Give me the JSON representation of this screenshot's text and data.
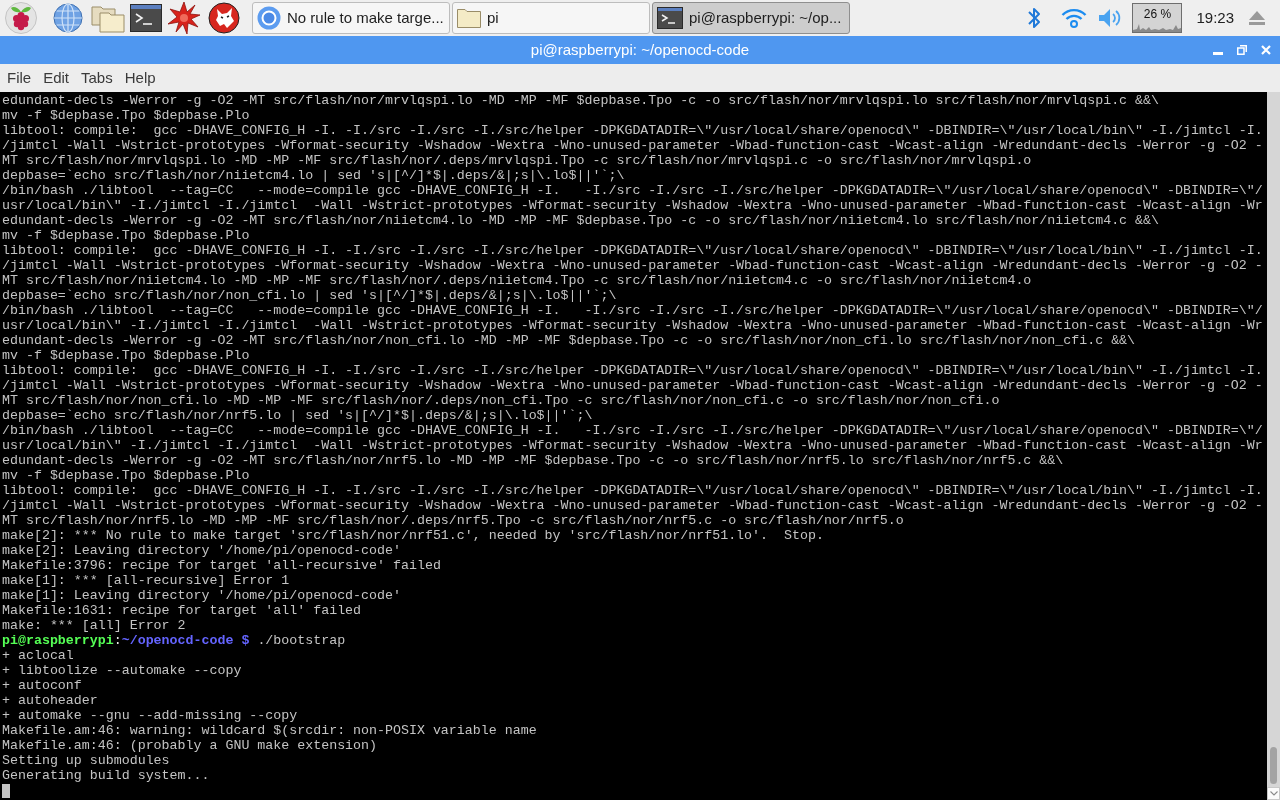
{
  "taskbar": {
    "tasks": [
      {
        "kind": "browser",
        "label": "No rule to make targe...",
        "selected": false
      },
      {
        "kind": "folder",
        "label": "pi",
        "selected": false
      },
      {
        "kind": "terminal",
        "label": "pi@raspberrypi: ~/op...",
        "selected": true
      }
    ],
    "cpu": "26 %",
    "clock": "19:23"
  },
  "window": {
    "title": "pi@raspberrypi: ~/openocd-code"
  },
  "menu": [
    "File",
    "Edit",
    "Tabs",
    "Help"
  ],
  "terminal": {
    "lines": [
      {
        "kind": "output",
        "text": "edundant-decls -Werror -g -O2 -MT src/flash/nor/mrvlqspi.lo -MD -MP -MF $depbase.Tpo -c -o src/flash/nor/mrvlqspi.lo src/flash/nor/mrvlqspi.c &&\\"
      },
      {
        "kind": "output",
        "text": "mv -f $depbase.Tpo $depbase.Plo"
      },
      {
        "kind": "output",
        "text": "libtool: compile:  gcc -DHAVE_CONFIG_H -I. -I./src -I./src -I./src/helper -DPKGDATADIR=\\\"/usr/local/share/openocd\\\" -DBINDIR=\\\"/usr/local/bin\\\" -I./jimtcl -I."
      },
      {
        "kind": "output",
        "text": "/jimtcl -Wall -Wstrict-prototypes -Wformat-security -Wshadow -Wextra -Wno-unused-parameter -Wbad-function-cast -Wcast-align -Wredundant-decls -Werror -g -O2 -"
      },
      {
        "kind": "output",
        "text": "MT src/flash/nor/mrvlqspi.lo -MD -MP -MF src/flash/nor/.deps/mrvlqspi.Tpo -c src/flash/nor/mrvlqspi.c -o src/flash/nor/mrvlqspi.o"
      },
      {
        "kind": "output",
        "text": "depbase=`echo src/flash/nor/niietcm4.lo | sed 's|[^/]*$|.deps/&|;s|\\.lo$||'`;\\"
      },
      {
        "kind": "output",
        "text": "/bin/bash ./libtool  --tag=CC   --mode=compile gcc -DHAVE_CONFIG_H -I.   -I./src -I./src -I./src/helper -DPKGDATADIR=\\\"/usr/local/share/openocd\\\" -DBINDIR=\\\"/"
      },
      {
        "kind": "output",
        "text": "usr/local/bin\\\" -I./jimtcl -I./jimtcl  -Wall -Wstrict-prototypes -Wformat-security -Wshadow -Wextra -Wno-unused-parameter -Wbad-function-cast -Wcast-align -Wr"
      },
      {
        "kind": "output",
        "text": "edundant-decls -Werror -g -O2 -MT src/flash/nor/niietcm4.lo -MD -MP -MF $depbase.Tpo -c -o src/flash/nor/niietcm4.lo src/flash/nor/niietcm4.c &&\\"
      },
      {
        "kind": "output",
        "text": "mv -f $depbase.Tpo $depbase.Plo"
      },
      {
        "kind": "output",
        "text": "libtool: compile:  gcc -DHAVE_CONFIG_H -I. -I./src -I./src -I./src/helper -DPKGDATADIR=\\\"/usr/local/share/openocd\\\" -DBINDIR=\\\"/usr/local/bin\\\" -I./jimtcl -I."
      },
      {
        "kind": "output",
        "text": "/jimtcl -Wall -Wstrict-prototypes -Wformat-security -Wshadow -Wextra -Wno-unused-parameter -Wbad-function-cast -Wcast-align -Wredundant-decls -Werror -g -O2 -"
      },
      {
        "kind": "output",
        "text": "MT src/flash/nor/niietcm4.lo -MD -MP -MF src/flash/nor/.deps/niietcm4.Tpo -c src/flash/nor/niietcm4.c -o src/flash/nor/niietcm4.o"
      },
      {
        "kind": "output",
        "text": "depbase=`echo src/flash/nor/non_cfi.lo | sed 's|[^/]*$|.deps/&|;s|\\.lo$||'`;\\"
      },
      {
        "kind": "output",
        "text": "/bin/bash ./libtool  --tag=CC   --mode=compile gcc -DHAVE_CONFIG_H -I.   -I./src -I./src -I./src/helper -DPKGDATADIR=\\\"/usr/local/share/openocd\\\" -DBINDIR=\\\"/"
      },
      {
        "kind": "output",
        "text": "usr/local/bin\\\" -I./jimtcl -I./jimtcl  -Wall -Wstrict-prototypes -Wformat-security -Wshadow -Wextra -Wno-unused-parameter -Wbad-function-cast -Wcast-align -Wr"
      },
      {
        "kind": "output",
        "text": "edundant-decls -Werror -g -O2 -MT src/flash/nor/non_cfi.lo -MD -MP -MF $depbase.Tpo -c -o src/flash/nor/non_cfi.lo src/flash/nor/non_cfi.c &&\\"
      },
      {
        "kind": "output",
        "text": "mv -f $depbase.Tpo $depbase.Plo"
      },
      {
        "kind": "output",
        "text": "libtool: compile:  gcc -DHAVE_CONFIG_H -I. -I./src -I./src -I./src/helper -DPKGDATADIR=\\\"/usr/local/share/openocd\\\" -DBINDIR=\\\"/usr/local/bin\\\" -I./jimtcl -I."
      },
      {
        "kind": "output",
        "text": "/jimtcl -Wall -Wstrict-prototypes -Wformat-security -Wshadow -Wextra -Wno-unused-parameter -Wbad-function-cast -Wcast-align -Wredundant-decls -Werror -g -O2 -"
      },
      {
        "kind": "output",
        "text": "MT src/flash/nor/non_cfi.lo -MD -MP -MF src/flash/nor/.deps/non_cfi.Tpo -c src/flash/nor/non_cfi.c -o src/flash/nor/non_cfi.o"
      },
      {
        "kind": "output",
        "text": "depbase=`echo src/flash/nor/nrf5.lo | sed 's|[^/]*$|.deps/&|;s|\\.lo$||'`;\\"
      },
      {
        "kind": "output",
        "text": "/bin/bash ./libtool  --tag=CC   --mode=compile gcc -DHAVE_CONFIG_H -I.   -I./src -I./src -I./src/helper -DPKGDATADIR=\\\"/usr/local/share/openocd\\\" -DBINDIR=\\\"/"
      },
      {
        "kind": "output",
        "text": "usr/local/bin\\\" -I./jimtcl -I./jimtcl  -Wall -Wstrict-prototypes -Wformat-security -Wshadow -Wextra -Wno-unused-parameter -Wbad-function-cast -Wcast-align -Wr"
      },
      {
        "kind": "output",
        "text": "edundant-decls -Werror -g -O2 -MT src/flash/nor/nrf5.lo -MD -MP -MF $depbase.Tpo -c -o src/flash/nor/nrf5.lo src/flash/nor/nrf5.c &&\\"
      },
      {
        "kind": "output",
        "text": "mv -f $depbase.Tpo $depbase.Plo"
      },
      {
        "kind": "output",
        "text": "libtool: compile:  gcc -DHAVE_CONFIG_H -I. -I./src -I./src -I./src/helper -DPKGDATADIR=\\\"/usr/local/share/openocd\\\" -DBINDIR=\\\"/usr/local/bin\\\" -I./jimtcl -I."
      },
      {
        "kind": "output",
        "text": "/jimtcl -Wall -Wstrict-prototypes -Wformat-security -Wshadow -Wextra -Wno-unused-parameter -Wbad-function-cast -Wcast-align -Wredundant-decls -Werror -g -O2 -"
      },
      {
        "kind": "output",
        "text": "MT src/flash/nor/nrf5.lo -MD -MP -MF src/flash/nor/.deps/nrf5.Tpo -c src/flash/nor/nrf5.c -o src/flash/nor/nrf5.o"
      },
      {
        "kind": "output",
        "text": "make[2]: *** No rule to make target 'src/flash/nor/nrf51.c', needed by 'src/flash/nor/nrf51.lo'.  Stop."
      },
      {
        "kind": "output",
        "text": "make[2]: Leaving directory '/home/pi/openocd-code'"
      },
      {
        "kind": "output",
        "text": "Makefile:3796: recipe for target 'all-recursive' failed"
      },
      {
        "kind": "output",
        "text": "make[1]: *** [all-recursive] Error 1"
      },
      {
        "kind": "output",
        "text": "make[1]: Leaving directory '/home/pi/openocd-code'"
      },
      {
        "kind": "output",
        "text": "Makefile:1631: recipe for target 'all' failed"
      },
      {
        "kind": "output",
        "text": "make: *** [all] Error 2"
      },
      {
        "kind": "prompt",
        "user": "pi@raspberrypi",
        "separator": ":",
        "path": "~/openocd-code $",
        "command": "./bootstrap"
      },
      {
        "kind": "output",
        "text": "+ aclocal"
      },
      {
        "kind": "output",
        "text": "+ libtoolize --automake --copy"
      },
      {
        "kind": "output",
        "text": "+ autoconf"
      },
      {
        "kind": "output",
        "text": "+ autoheader"
      },
      {
        "kind": "output",
        "text": "+ automake --gnu --add-missing --copy"
      },
      {
        "kind": "output",
        "text": "Makefile.am:46: warning: wildcard $(srcdir: non-POSIX variable name"
      },
      {
        "kind": "output",
        "text": "Makefile.am:46: (probably a GNU make extension)"
      },
      {
        "kind": "output",
        "text": "Setting up submodules"
      },
      {
        "kind": "output",
        "text": "Generating build system..."
      }
    ]
  }
}
